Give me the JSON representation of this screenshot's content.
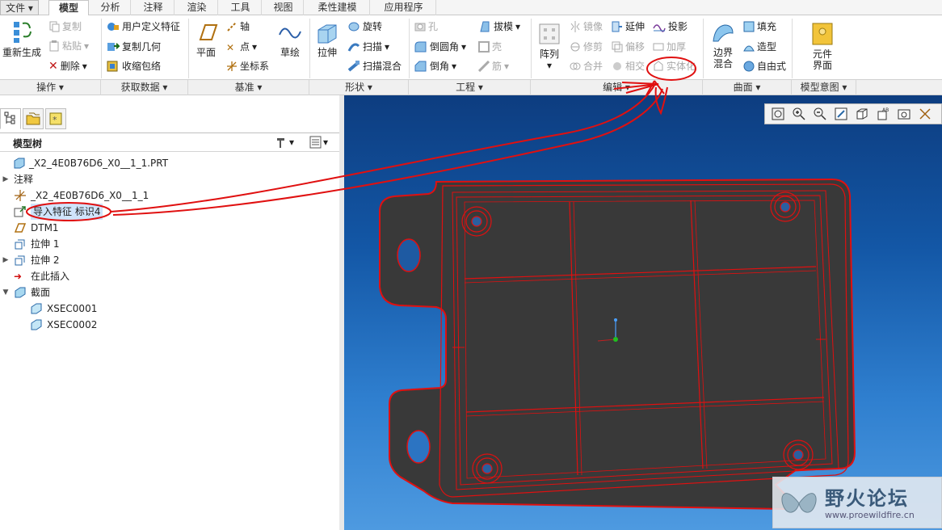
{
  "menu": {
    "tabs": [
      "文件",
      "模型",
      "分析",
      "注释",
      "渲染",
      "工具",
      "视图",
      "柔性建模",
      "应用程序"
    ],
    "active": "模型"
  },
  "ribbon": {
    "operations": {
      "regenerate": "重新生成",
      "copy": "复制",
      "paste": "粘贴",
      "delete": "删除"
    },
    "get_data": {
      "udf": "用户定义特征",
      "copy_geometry": "复制几何",
      "shrinkwrap": "收缩包络"
    },
    "datum": {
      "plane": "平面",
      "axis": "轴",
      "point": "点",
      "csys": "坐标系",
      "sketch": "草绘"
    },
    "shapes": {
      "extrude": "拉伸",
      "revolve": "旋转",
      "sweep": "扫描",
      "swept_blend": "扫描混合"
    },
    "engineering": {
      "hole": "孔",
      "round": "倒圆角",
      "chamfer": "倒角",
      "draft": "拔模",
      "shell": "壳",
      "rib": "筋"
    },
    "editing": {
      "pattern": "阵列",
      "mirror": "镜像",
      "trim": "修剪",
      "merge": "合并",
      "extend": "延伸",
      "offset": "偏移",
      "intersect": "相交",
      "project": "投影",
      "thicken": "加厚",
      "solidify": "实体化"
    },
    "surfaces": {
      "boundary_blend": "边界混合",
      "fill": "填充",
      "style": "造型",
      "freestyle": "自由式"
    },
    "model_intent": {
      "component_interface": "元件界面"
    }
  },
  "groups": [
    "操作",
    "获取数据",
    "基准",
    "形状",
    "工程",
    "编辑",
    "曲面",
    "模型意图"
  ],
  "model_tree": {
    "title": "模型树",
    "items": [
      {
        "label": "_X2_4E0B76D6_X0__1_1.PRT",
        "icon": "part-icon"
      },
      {
        "label": "注释",
        "icon": "annotation-icon"
      },
      {
        "label": "_X2_4E0B76D6_X0__1_1",
        "icon": "csys-icon"
      },
      {
        "label": "导入特征 标识4",
        "icon": "import-feature-icon"
      },
      {
        "label": "DTM1",
        "icon": "datum-plane-icon"
      },
      {
        "label": "拉伸 1",
        "icon": "extrude-icon"
      },
      {
        "label": "拉伸 2",
        "icon": "extrude-icon"
      },
      {
        "label": "在此插入",
        "icon": "insert-here-arrow-icon"
      },
      {
        "label": "截面",
        "icon": "section-icon"
      },
      {
        "label": "XSEC0001",
        "icon": "xsec-icon"
      },
      {
        "label": "XSEC0002",
        "icon": "xsec-icon"
      }
    ]
  },
  "watermark": {
    "name": "野火论坛",
    "url": "www.proewildfire.cn"
  },
  "colors": {
    "viewport_top": "#0d3d80",
    "viewport_bottom": "#4e9ae0",
    "annotation_red": "#e01010",
    "part_fill": "#3a3a3a"
  }
}
